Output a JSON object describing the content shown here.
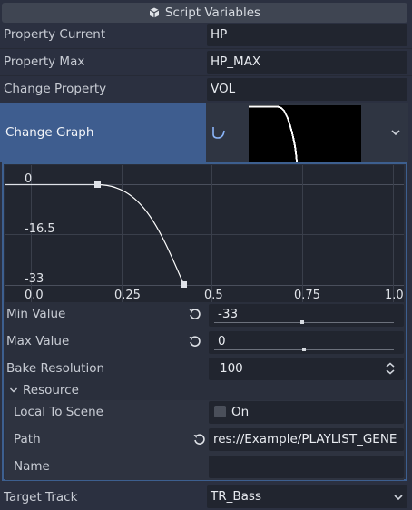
{
  "header": {
    "title": "Script Variables",
    "icon": "script-icon"
  },
  "properties": {
    "property_current": {
      "label": "Property Current",
      "value": "HP"
    },
    "property_max": {
      "label": "Property Max",
      "value": "HP_MAX"
    },
    "change_property": {
      "label": "Change Property",
      "value": "VOL"
    },
    "change_graph": {
      "label": "Change Graph",
      "icon": "curve-icon",
      "dropdown_icon": "chevron-down-icon"
    },
    "target_track": {
      "label": "Target Track",
      "value": "TR_Bass"
    }
  },
  "curve": {
    "y_labels": [
      "0",
      "-16.5",
      "-33"
    ],
    "x_labels": [
      "0.0",
      "0.25",
      "0.5",
      "0.75",
      "1.0"
    ],
    "min_value": {
      "label": "Min Value",
      "value": "-33",
      "slider_fraction": 0.52
    },
    "max_value": {
      "label": "Max Value",
      "value": "0",
      "slider_fraction": 0.53
    },
    "bake_resolution": {
      "label": "Bake Resolution",
      "value": "100"
    },
    "resource": {
      "label": "Resource"
    },
    "local_to_scene": {
      "label": "Local To Scene",
      "value": "On"
    },
    "path": {
      "label": "Path",
      "value": "res://Example/PLAYLIST_GENE"
    },
    "name": {
      "label": "Name",
      "value": ""
    }
  },
  "colors": {
    "background": "#2b3040",
    "selected": "#3e5d8f",
    "accent_border": "#3d5f8f",
    "field": "#21252f"
  }
}
